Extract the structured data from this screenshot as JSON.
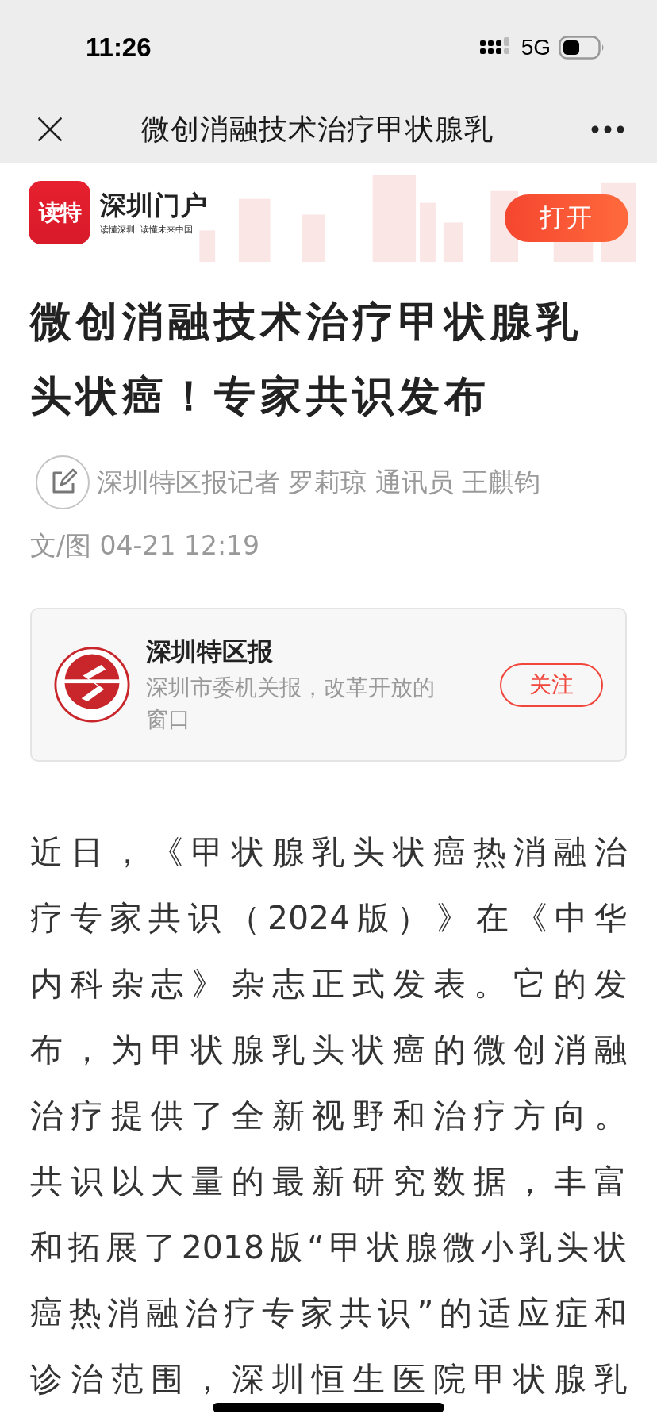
{
  "status_bar": {
    "time": "11:26",
    "network": "5G"
  },
  "nav_bar": {
    "title": "微创消融技术治疗甲状腺乳"
  },
  "app_banner": {
    "logo_text": "读特",
    "brand": "深圳门户",
    "slogan": "读懂深圳  读懂未来中国",
    "open_button": "打开"
  },
  "article": {
    "title": "微创消融技术治疗甲状腺乳头状癌！专家共识发布",
    "byline_lines": [
      "深圳特区报记者 罗莉琼 通讯员 王麒钧",
      "文/图 04-21 12:19"
    ],
    "source": {
      "name": "深圳特区报",
      "description": "深圳市委机关报，改革开放的窗口",
      "follow_button": "关注",
      "followed": false
    },
    "body_lines": [
      "近日，《甲状腺乳头状癌热消融治",
      "疗专家共识（2024版）》在《中华",
      "内科杂志》杂志正式发表。它的发",
      "布，为甲状腺乳头状癌的微创消融",
      "治疗提供了全新视野和治疗方向。",
      "共识以大量的最新研究数据，丰富",
      "和拓展了2018版“甲状腺微小乳头状",
      "癌热消融治疗专家共识”的适应症和",
      "诊治范围，深圳恒生医院甲状腺乳"
    ]
  }
}
